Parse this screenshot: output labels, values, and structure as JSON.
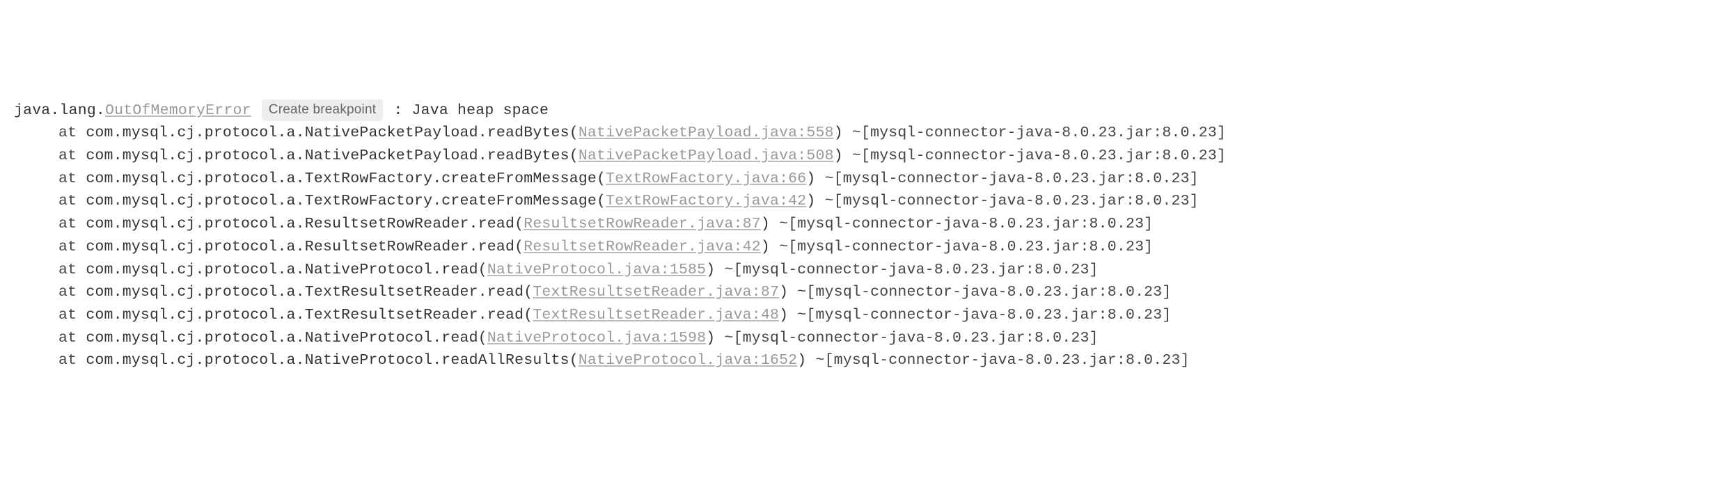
{
  "exception": {
    "prefix": "java.lang.",
    "class": "OutOfMemoryError",
    "breakpoint_label": "Create breakpoint",
    "separator": " : ",
    "message": "Java heap space"
  },
  "at_label": "at ",
  "jar_info": " ~[mysql-connector-java-8.0.23.jar:8.0.23]",
  "frames": [
    {
      "method": "com.mysql.cj.protocol.a.NativePacketPayload.readBytes(",
      "link": "NativePacketPayload.java:558",
      "close": ")"
    },
    {
      "method": "com.mysql.cj.protocol.a.NativePacketPayload.readBytes(",
      "link": "NativePacketPayload.java:508",
      "close": ")"
    },
    {
      "method": "com.mysql.cj.protocol.a.TextRowFactory.createFromMessage(",
      "link": "TextRowFactory.java:66",
      "close": ")"
    },
    {
      "method": "com.mysql.cj.protocol.a.TextRowFactory.createFromMessage(",
      "link": "TextRowFactory.java:42",
      "close": ")"
    },
    {
      "method": "com.mysql.cj.protocol.a.ResultsetRowReader.read(",
      "link": "ResultsetRowReader.java:87",
      "close": ")"
    },
    {
      "method": "com.mysql.cj.protocol.a.ResultsetRowReader.read(",
      "link": "ResultsetRowReader.java:42",
      "close": ")"
    },
    {
      "method": "com.mysql.cj.protocol.a.NativeProtocol.read(",
      "link": "NativeProtocol.java:1585",
      "close": ")"
    },
    {
      "method": "com.mysql.cj.protocol.a.TextResultsetReader.read(",
      "link": "TextResultsetReader.java:87",
      "close": ")"
    },
    {
      "method": "com.mysql.cj.protocol.a.TextResultsetReader.read(",
      "link": "TextResultsetReader.java:48",
      "close": ")"
    },
    {
      "method": "com.mysql.cj.protocol.a.NativeProtocol.read(",
      "link": "NativeProtocol.java:1598",
      "close": ")"
    },
    {
      "method": "com.mysql.cj.protocol.a.NativeProtocol.readAllResults(",
      "link": "NativeProtocol.java:1652",
      "close": ")"
    }
  ]
}
